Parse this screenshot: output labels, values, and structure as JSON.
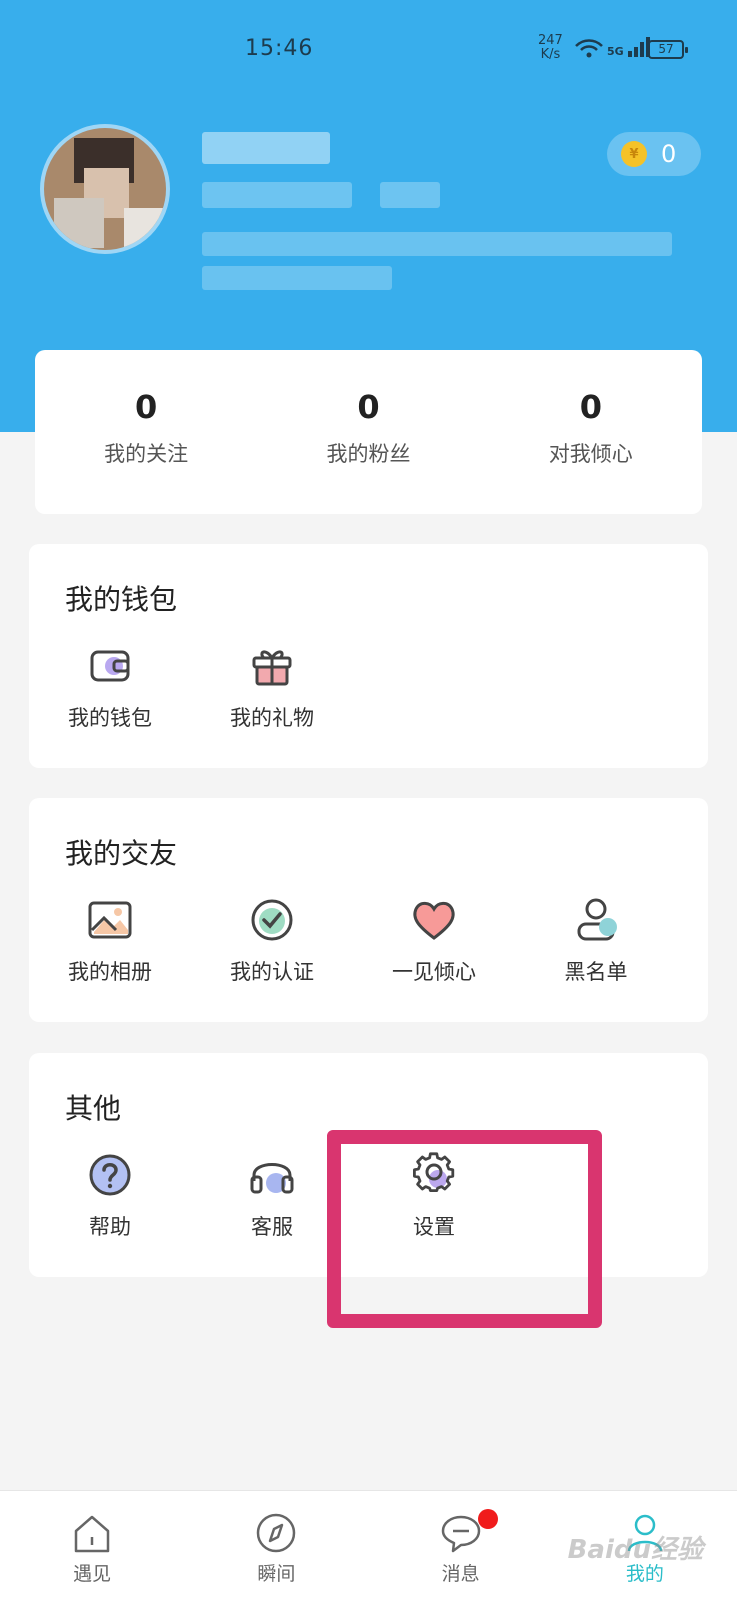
{
  "status_bar": {
    "time": "15:46",
    "net_speed": "247\nK/s",
    "net_type": "5G",
    "battery": "57"
  },
  "profile": {
    "coins": "0",
    "coin_symbol": "¥"
  },
  "stats": [
    {
      "value": "0",
      "label": "我的关注"
    },
    {
      "value": "0",
      "label": "我的粉丝"
    },
    {
      "value": "0",
      "label": "对我倾心"
    }
  ],
  "wallet_section": {
    "title": "我的钱包",
    "items": [
      {
        "label": "我的钱包",
        "icon": "wallet-icon"
      },
      {
        "label": "我的礼物",
        "icon": "gift-icon"
      }
    ]
  },
  "friends_section": {
    "title": "我的交友",
    "items": [
      {
        "label": "我的相册",
        "icon": "album-icon"
      },
      {
        "label": "我的认证",
        "icon": "verify-icon"
      },
      {
        "label": "一见倾心",
        "icon": "heart-icon"
      },
      {
        "label": "黑名单",
        "icon": "blacklist-icon"
      }
    ]
  },
  "other_section": {
    "title": "其他",
    "items": [
      {
        "label": "帮助",
        "icon": "help-icon"
      },
      {
        "label": "客服",
        "icon": "headset-icon"
      },
      {
        "label": "设置",
        "icon": "gear-icon"
      }
    ]
  },
  "tabbar": [
    {
      "label": "遇见",
      "icon": "home-icon"
    },
    {
      "label": "瞬间",
      "icon": "compass-icon"
    },
    {
      "label": "消息",
      "icon": "chat-icon"
    },
    {
      "label": "我的",
      "icon": "user-icon"
    }
  ],
  "watermark": "Baidu经验",
  "colors": {
    "header": "#38aeec",
    "accent": "#2bbdc9",
    "highlight": "#d9356f",
    "badge": "#f01c1c"
  }
}
